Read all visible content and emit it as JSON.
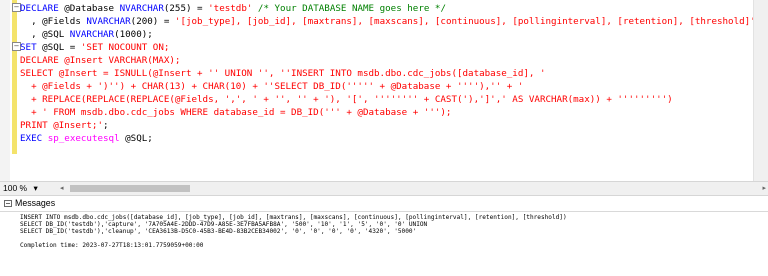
{
  "editor": {
    "lines": [
      [
        {
          "t": "DECLARE",
          "c": "kw"
        },
        {
          "t": " @Database ",
          "c": ""
        },
        {
          "t": "NVARCHAR",
          "c": "kw"
        },
        {
          "t": "(255) = ",
          "c": ""
        },
        {
          "t": "'testdb'",
          "c": "str"
        },
        {
          "t": " /* Your DATABASE NAME goes here */",
          "c": "cmt"
        }
      ],
      [
        {
          "t": "  , @Fields ",
          "c": ""
        },
        {
          "t": "NVARCHAR",
          "c": "kw"
        },
        {
          "t": "(200) = ",
          "c": ""
        },
        {
          "t": "'[job_type], [job_id], [maxtrans], [maxscans], [continuous], [pollinginterval], [retention], [threshold]'",
          "c": "str"
        }
      ],
      [
        {
          "t": "  , @SQL ",
          "c": ""
        },
        {
          "t": "NVARCHAR",
          "c": "kw"
        },
        {
          "t": "(1000);",
          "c": ""
        }
      ],
      [
        {
          "t": "SET",
          "c": "kw"
        },
        {
          "t": " @SQL = ",
          "c": ""
        },
        {
          "t": "'SET NOCOUNT ON;",
          "c": "str"
        }
      ],
      [
        {
          "t": "DECLARE @Insert VARCHAR(MAX);",
          "c": "str"
        }
      ],
      [
        {
          "t": "SELECT @Insert = ISNULL(@Insert + '' UNION '', ''INSERT INTO msdb.dbo.cdc_jobs([database_id], '",
          "c": "str"
        }
      ],
      [
        {
          "t": "  + @Fields + ')'') + CHAR(13) + CHAR(10) + ''SELECT DB_ID(''''' + @Database + ''''),'' + '",
          "c": "str"
        }
      ],
      [
        {
          "t": "  + REPLACE(REPLACE(REPLACE(@Fields, ',', ' + '', '' + '), '[', '''''''' + CAST('),']',' AS VARCHAR(max)) + ''''''''')",
          "c": "str"
        }
      ],
      [
        {
          "t": "  + ' FROM msdb.dbo.cdc_jobs WHERE database_id = DB_ID(''' + @Database + ''');",
          "c": "str"
        }
      ],
      [
        {
          "t": "PRINT @Insert;'",
          "c": "str"
        },
        {
          "t": ";",
          "c": ""
        }
      ],
      [
        {
          "t": "EXEC",
          "c": "kw"
        },
        {
          "t": " ",
          "c": ""
        },
        {
          "t": "sp_executesql",
          "c": "fn"
        },
        {
          "t": " @SQL;",
          "c": ""
        }
      ]
    ]
  },
  "statusbar": {
    "zoom": "100 %",
    "zoom_caret": "▾",
    "scroll_left": "◂",
    "scroll_right": "▸"
  },
  "results": {
    "tab_label": "Messages",
    "lines": [
      "INSERT INTO msdb.dbo.cdc_jobs([database_id], [job_type], [job_id], [maxtrans], [maxscans], [continuous], [pollinginterval], [retention], [threshold])",
      "SELECT DB_ID('testdb'),'capture', '7A705A4E-2DDD-47D9-A85E-3E7FBA5AFB8A', '500', '10', '1', '5', '0', '0' UNION",
      "SELECT DB_ID('testdb'),'cleanup', 'CEA3613B-D5C0-45B3-BE4D-83B2CEB34002', '0', '0', '0', '0', '4320', '5000'",
      "",
      "Completion time: 2023-07-27T18:13:01.7759059+00:00"
    ]
  }
}
